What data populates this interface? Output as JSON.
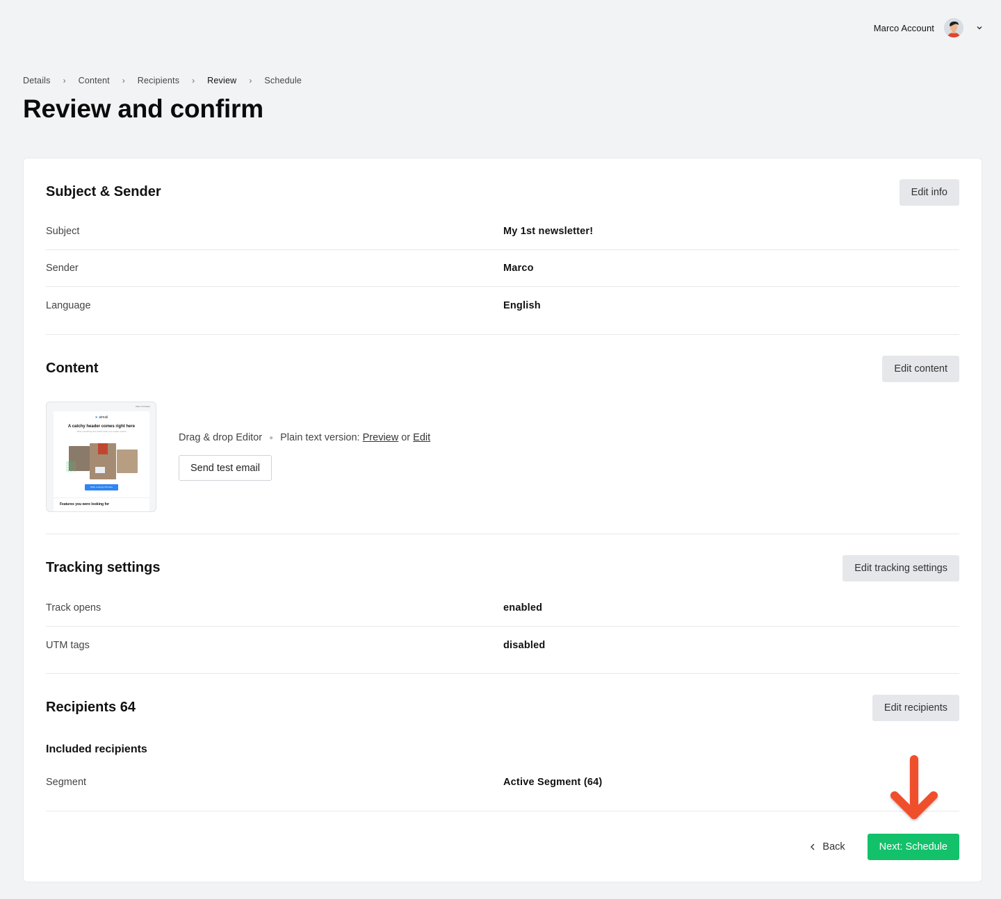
{
  "header": {
    "account_name": "Marco Account",
    "avatar_icon": "user-avatar",
    "dropdown_icon": "chevron-down-icon"
  },
  "breadcrumb": {
    "items": [
      {
        "label": "Details",
        "active": false
      },
      {
        "label": "Content",
        "active": false
      },
      {
        "label": "Recipients",
        "active": false
      },
      {
        "label": "Review",
        "active": true
      },
      {
        "label": "Schedule",
        "active": false
      }
    ],
    "separator": "›"
  },
  "page": {
    "title": "Review and confirm"
  },
  "subject_sender": {
    "title": "Subject & Sender",
    "edit_label": "Edit info",
    "rows": [
      {
        "label": "Subject",
        "value": "My 1st newsletter!"
      },
      {
        "label": "Sender",
        "value": "Marco"
      },
      {
        "label": "Language",
        "value": "English"
      }
    ]
  },
  "content": {
    "title": "Content",
    "edit_label": "Edit content",
    "editor_type": "Drag & drop Editor",
    "plain_text_label": "Plain text version:",
    "preview_link": "Preview",
    "or_text": "or",
    "edit_link": "Edit",
    "send_test_label": "Send test email",
    "thumbnail": {
      "brand": "aimail",
      "header": "A catchy header comes right here",
      "subtext": "Write something here that'll make your reader excited",
      "cta": "Write a strong CTA here",
      "features_heading": "Features you were looking for",
      "top_link": "View in browser"
    }
  },
  "tracking": {
    "title": "Tracking settings",
    "edit_label": "Edit tracking settings",
    "rows": [
      {
        "label": "Track opens",
        "value": "enabled"
      },
      {
        "label": "UTM tags",
        "value": "disabled"
      }
    ]
  },
  "recipients": {
    "title": "Recipients 64",
    "edit_label": "Edit recipients",
    "included_heading": "Included recipients",
    "rows": [
      {
        "label": "Segment",
        "value": "Active Segment (64)"
      }
    ]
  },
  "footer": {
    "back_label": "Back",
    "next_label": "Next: Schedule"
  },
  "colors": {
    "primary_green": "#12c16a",
    "annotation_arrow": "#ef4f2b",
    "background": "#f2f3f5"
  }
}
